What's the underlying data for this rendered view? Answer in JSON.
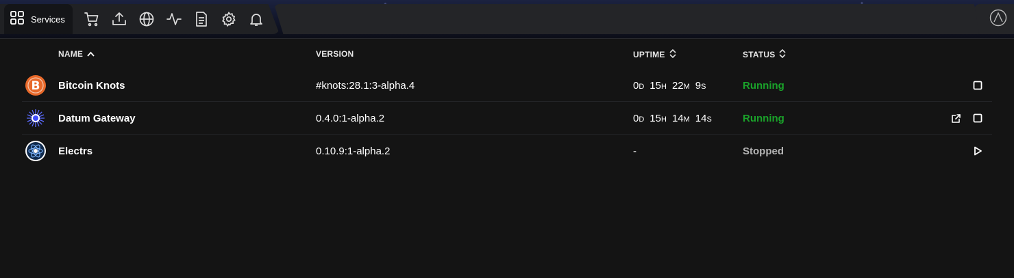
{
  "nav": {
    "services_label": "Services",
    "icons": [
      "grid-icon",
      "cart-icon",
      "upload-icon",
      "globe-icon",
      "activity-icon",
      "document-icon",
      "gear-icon",
      "bell-icon",
      "logo-icon"
    ]
  },
  "table": {
    "headers": {
      "name": "NAME",
      "version": "VERSION",
      "uptime": "UPTIME",
      "status": "STATUS"
    },
    "rows": [
      {
        "name": "Bitcoin Knots",
        "version": "#knots:28.1:3-alpha.4",
        "uptime": {
          "d": "0",
          "h": "15",
          "m": "22",
          "s": "9"
        },
        "status": "Running"
      },
      {
        "name": "Datum Gateway",
        "version": "0.4.0:1-alpha.2",
        "uptime": {
          "d": "0",
          "h": "15",
          "m": "14",
          "s": "14"
        },
        "status": "Running"
      },
      {
        "name": "Electrs",
        "version": "0.10.9:1-alpha.2",
        "uptime_text": "-",
        "status": "Stopped"
      }
    ],
    "unit_labels": {
      "d": "D",
      "h": "H",
      "m": "M",
      "s": "S"
    }
  },
  "colors": {
    "running": "#1aa32a",
    "stopped": "#b4b4b4",
    "background": "#141414"
  }
}
